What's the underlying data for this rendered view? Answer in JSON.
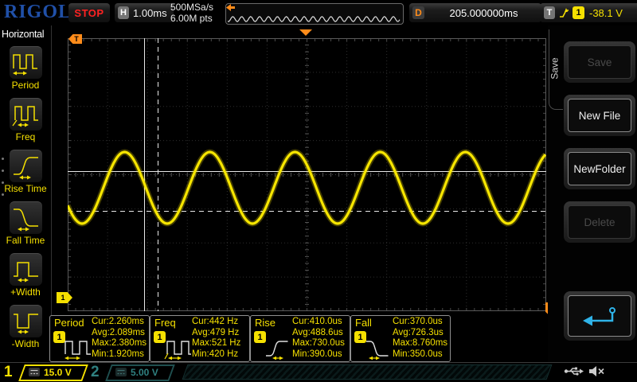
{
  "brand": "RIGOL",
  "top_bar": {
    "run_state": "STOP",
    "horizontal": {
      "label": "H",
      "scale": "1.00ms"
    },
    "acquisition": {
      "sample_rate": "500MSa/s",
      "memory_depth": "6.00M pts"
    },
    "delay": {
      "label": "D",
      "value": "205.000000ms"
    },
    "trigger": {
      "label": "T",
      "slope_icon": "rising-edge-icon",
      "source": "1",
      "level": "-38.1 V"
    }
  },
  "left_menu": {
    "title": "Horizontal",
    "items": [
      {
        "label": "Period",
        "icon": "period-icon"
      },
      {
        "label": "Freq",
        "icon": "freq-icon"
      },
      {
        "label": "Rise Time",
        "icon": "rise-time-icon"
      },
      {
        "label": "Fall Time",
        "icon": "fall-time-icon"
      },
      {
        "label": "+Width",
        "icon": "plus-width-icon"
      },
      {
        "label": "-Width",
        "icon": "minus-width-icon"
      }
    ]
  },
  "display": {
    "waveform": {
      "shape": "sine",
      "channel": "1"
    },
    "markers": {
      "trigger_position_offscreen_label": "T",
      "trigger_level_label": "T",
      "channel_ground_label": "1"
    }
  },
  "measurements": [
    {
      "name": "Period",
      "source": "1",
      "icon": "period-wave-icon",
      "values": [
        "Cur:2.260ms",
        "Avg:2.089ms",
        "Max:2.380ms",
        "Min:1.920ms"
      ]
    },
    {
      "name": "Freq",
      "source": "1",
      "icon": "freq-wave-icon",
      "values": [
        "Cur:442 Hz",
        "Avg:479 Hz",
        "Max:521 Hz",
        "Min:420 Hz"
      ]
    },
    {
      "name": "Rise",
      "source": "1",
      "icon": "rise-edge-icon",
      "values": [
        "Cur:410.0us",
        "Avg:488.6us",
        "Max:730.0us",
        "Min:390.0us"
      ]
    },
    {
      "name": "Fall",
      "source": "1",
      "icon": "fall-edge-icon",
      "values": [
        "Cur:370.0us",
        "Avg:726.3us",
        "Max:8.760ms",
        "Min:350.0us"
      ]
    }
  ],
  "right_menu": {
    "tab_title": "Save",
    "buttons": [
      {
        "label": "Save",
        "enabled": false
      },
      {
        "label": "New File",
        "enabled": true
      },
      {
        "label": "NewFolder",
        "enabled": true
      },
      {
        "label": "Delete",
        "enabled": false
      }
    ],
    "back_button_icon": "return-arrow-icon"
  },
  "channel_bar": {
    "channels": [
      {
        "id": "1",
        "scale": "15.0 V",
        "coupling_icon": "dc-coupling-icon",
        "active": true
      },
      {
        "id": "2",
        "scale": "5.00 V",
        "coupling_icon": "dc-coupling-icon",
        "active": false
      }
    ],
    "status_icons": [
      "usb-icon",
      "speaker-muted-icon"
    ]
  },
  "colors": {
    "channel1_yellow": "#f5e000",
    "channel2_dim_cyan": "#2f8080",
    "trigger_orange": "#ff8c1a",
    "stop_red": "#ff2222",
    "logo_blue": "#2050a8",
    "back_arrow_blue": "#2fb3e8"
  }
}
